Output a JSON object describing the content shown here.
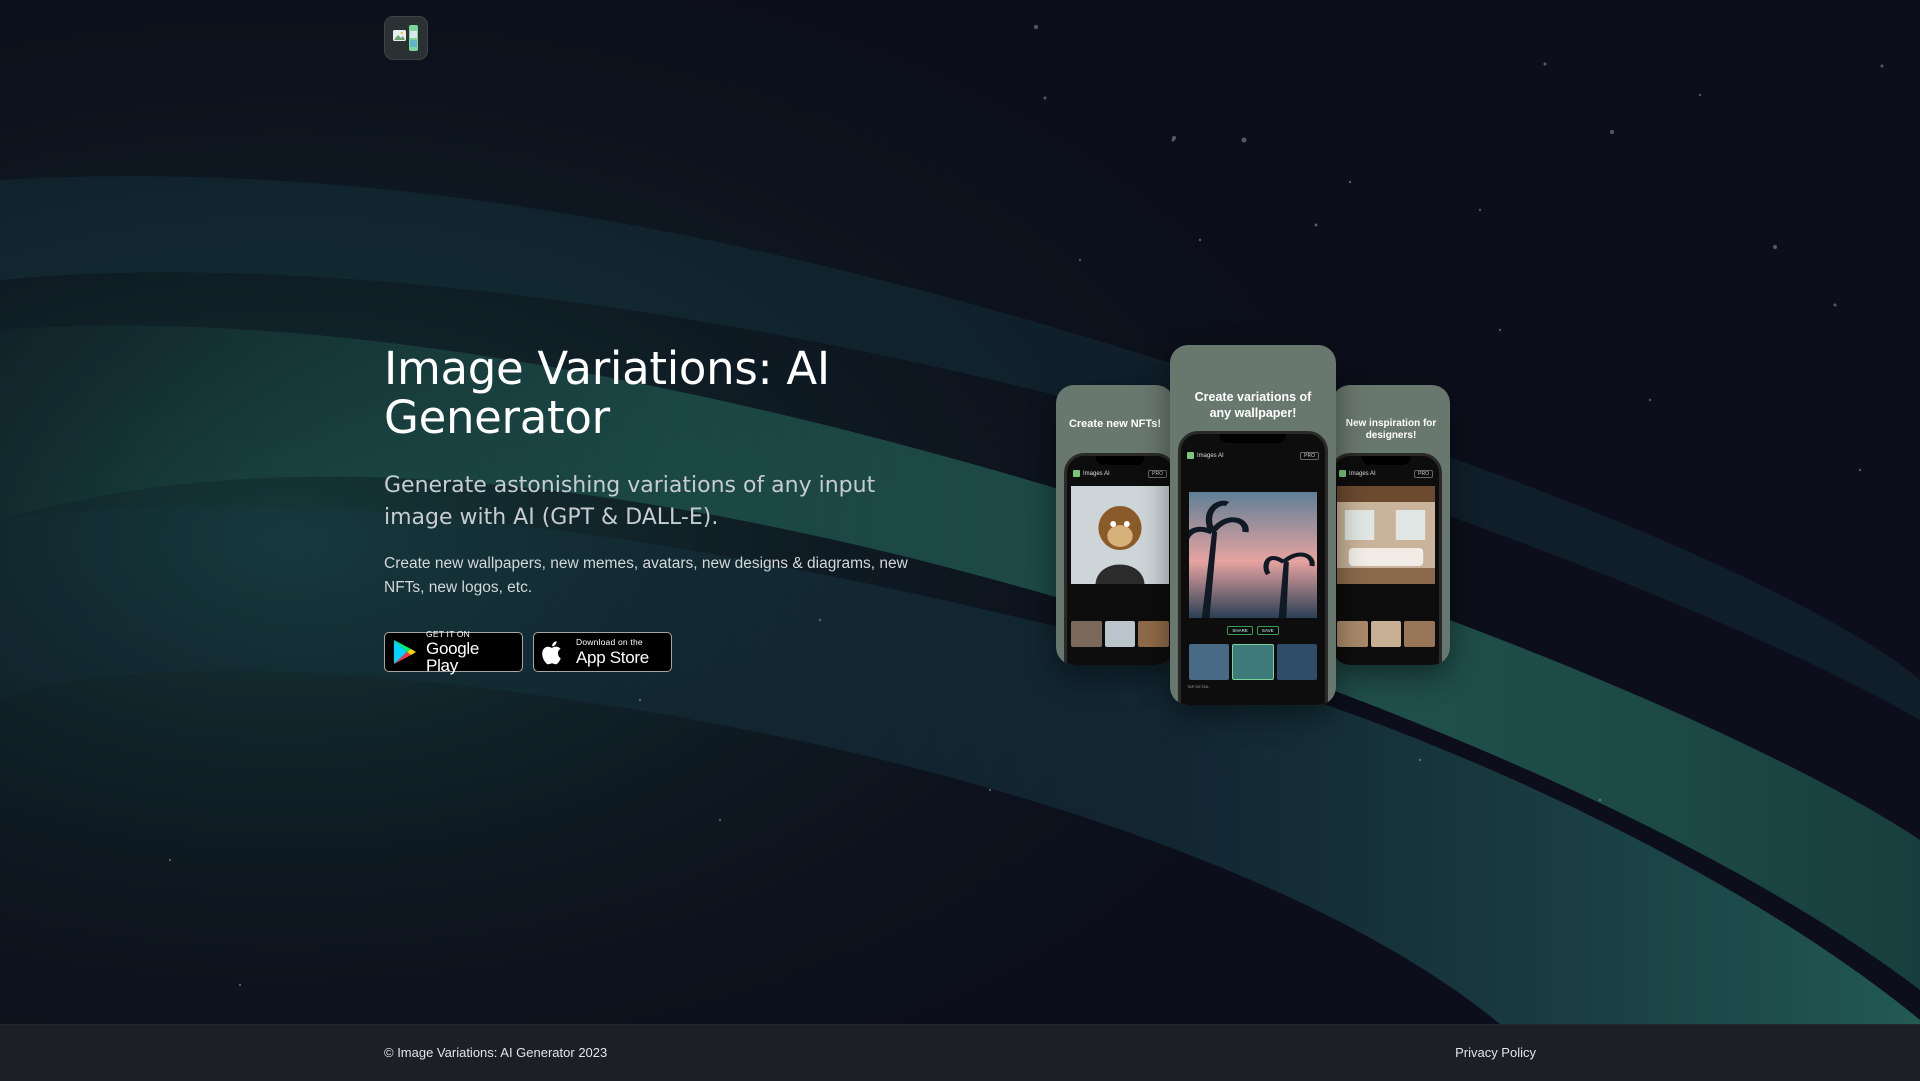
{
  "colors": {
    "background": "#0c0f1b",
    "aurora_green": "#2e7d69",
    "footer_bg": "#1c1f26",
    "card_bg": "#69786f"
  },
  "header": {
    "logo_icon": "image-variations-app-icon"
  },
  "hero": {
    "title": "Image Variations: AI Generator",
    "subtitle": "Generate astonishing variations of any input image with AI (GPT & DALL-E).",
    "description": "Create new wallpapers, new memes, avatars, new designs & diagrams, new NFTs, new logos, etc."
  },
  "stores": {
    "google_play": {
      "small": "GET IT ON",
      "big": "Google Play",
      "icon": "google-play-icon"
    },
    "app_store": {
      "small": "Download on the",
      "big": "App Store",
      "icon": "apple-icon"
    }
  },
  "mockups": {
    "left": {
      "caption": "Create new NFTs!",
      "app_name": "Images AI",
      "pro": "PRO"
    },
    "center": {
      "caption": "Create variations of any wallpaper!",
      "app_name": "Images AI",
      "pro": "PRO",
      "share": "SHARE",
      "save": "SAVE",
      "footnote": "TAP DETAIL"
    },
    "right": {
      "caption": "New inspiration for designers!",
      "app_name": "Images AI",
      "pro": "PRO"
    }
  },
  "footer": {
    "copyright": "© Image Variations: AI Generator 2023",
    "privacy": "Privacy Policy"
  }
}
